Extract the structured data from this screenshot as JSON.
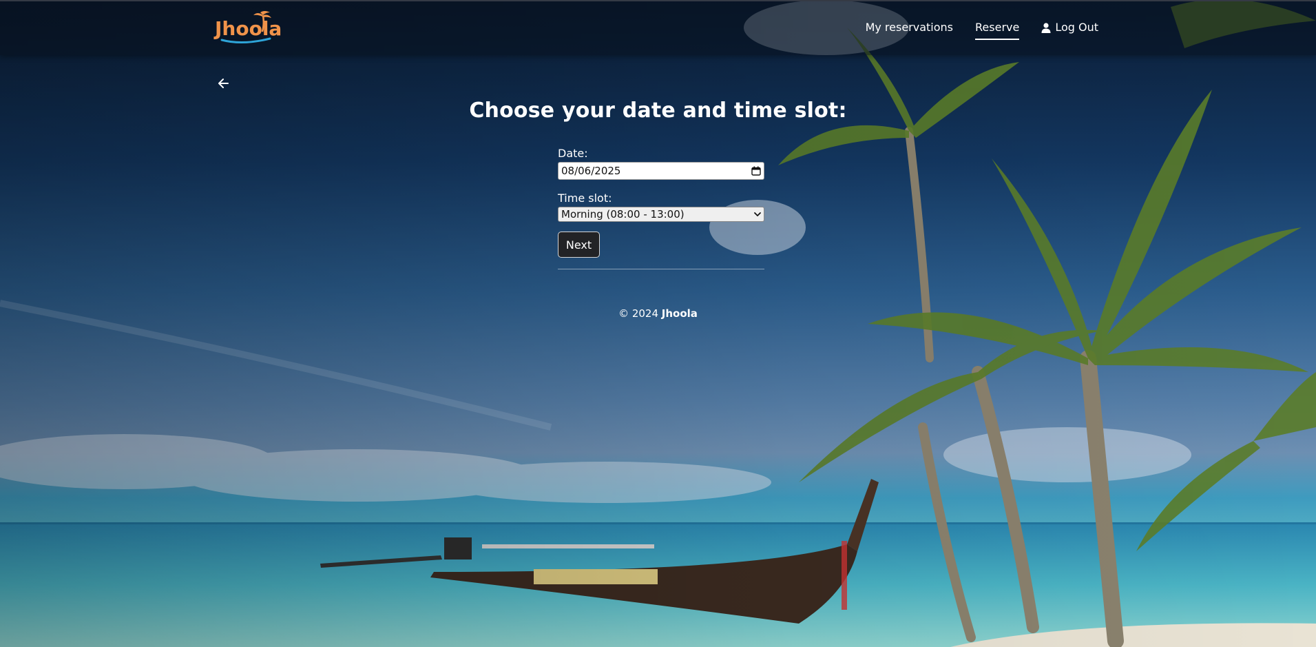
{
  "header": {
    "logo_text": "Jhoola",
    "nav": {
      "my_reservations": "My reservations",
      "reserve": "Reserve",
      "logout": "Log Out"
    }
  },
  "main": {
    "title": "Choose your date and time slot:",
    "date": {
      "label": "Date:",
      "value": "08/06/2025"
    },
    "time_slot": {
      "label": "Time slot:",
      "selected": "Morning (08:00 - 13:00)"
    },
    "next_label": "Next"
  },
  "footer": {
    "copyright": "© 2024",
    "brand": "Jhoola"
  },
  "colors": {
    "brand_orange": "#f0934a",
    "logo_wave": "#2ea4d8"
  },
  "icons": {
    "back": "arrow-left-icon",
    "user": "user-icon",
    "calendar": "calendar-icon",
    "dropdown": "chevron-down-icon",
    "logo": "palm-tree-icon"
  }
}
